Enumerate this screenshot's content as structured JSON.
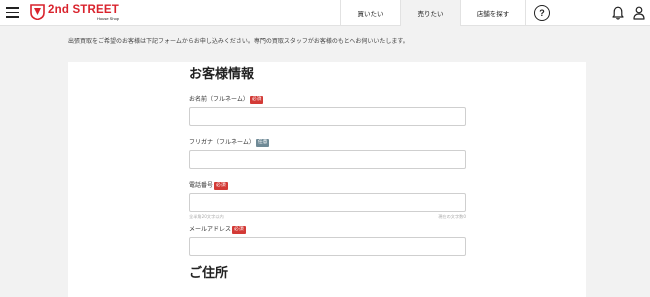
{
  "header": {
    "logo_text": "2nd STREET",
    "logo_sub": "House Shop",
    "nav": [
      {
        "label": "買いたい"
      },
      {
        "label": "売りたい"
      },
      {
        "label": "店舗を探す"
      }
    ],
    "help_label": "?"
  },
  "intro": "出張買取をご希望のお客様は下記フォームからお申し込みください。専門の買取スタッフがお客様のもとへお伺いいたします。",
  "sections": {
    "customer_info": "お客様情報",
    "address": "ご住所"
  },
  "fields": {
    "name": {
      "label": "お名前（フルネーム）",
      "badge": "必須",
      "value": ""
    },
    "furigana": {
      "label": "フリガナ（フルネーム）",
      "badge": "任意",
      "value": ""
    },
    "phone": {
      "label": "電話番号",
      "badge": "必須",
      "value": "",
      "hint_left": "全半角20文字以内",
      "hint_right": "現在の文字数0"
    },
    "email": {
      "label": "メールアドレス",
      "badge": "必須",
      "value": ""
    }
  },
  "colors": {
    "brand": "#d9232d",
    "required": "#d33a36",
    "optional": "#6f8a96"
  }
}
